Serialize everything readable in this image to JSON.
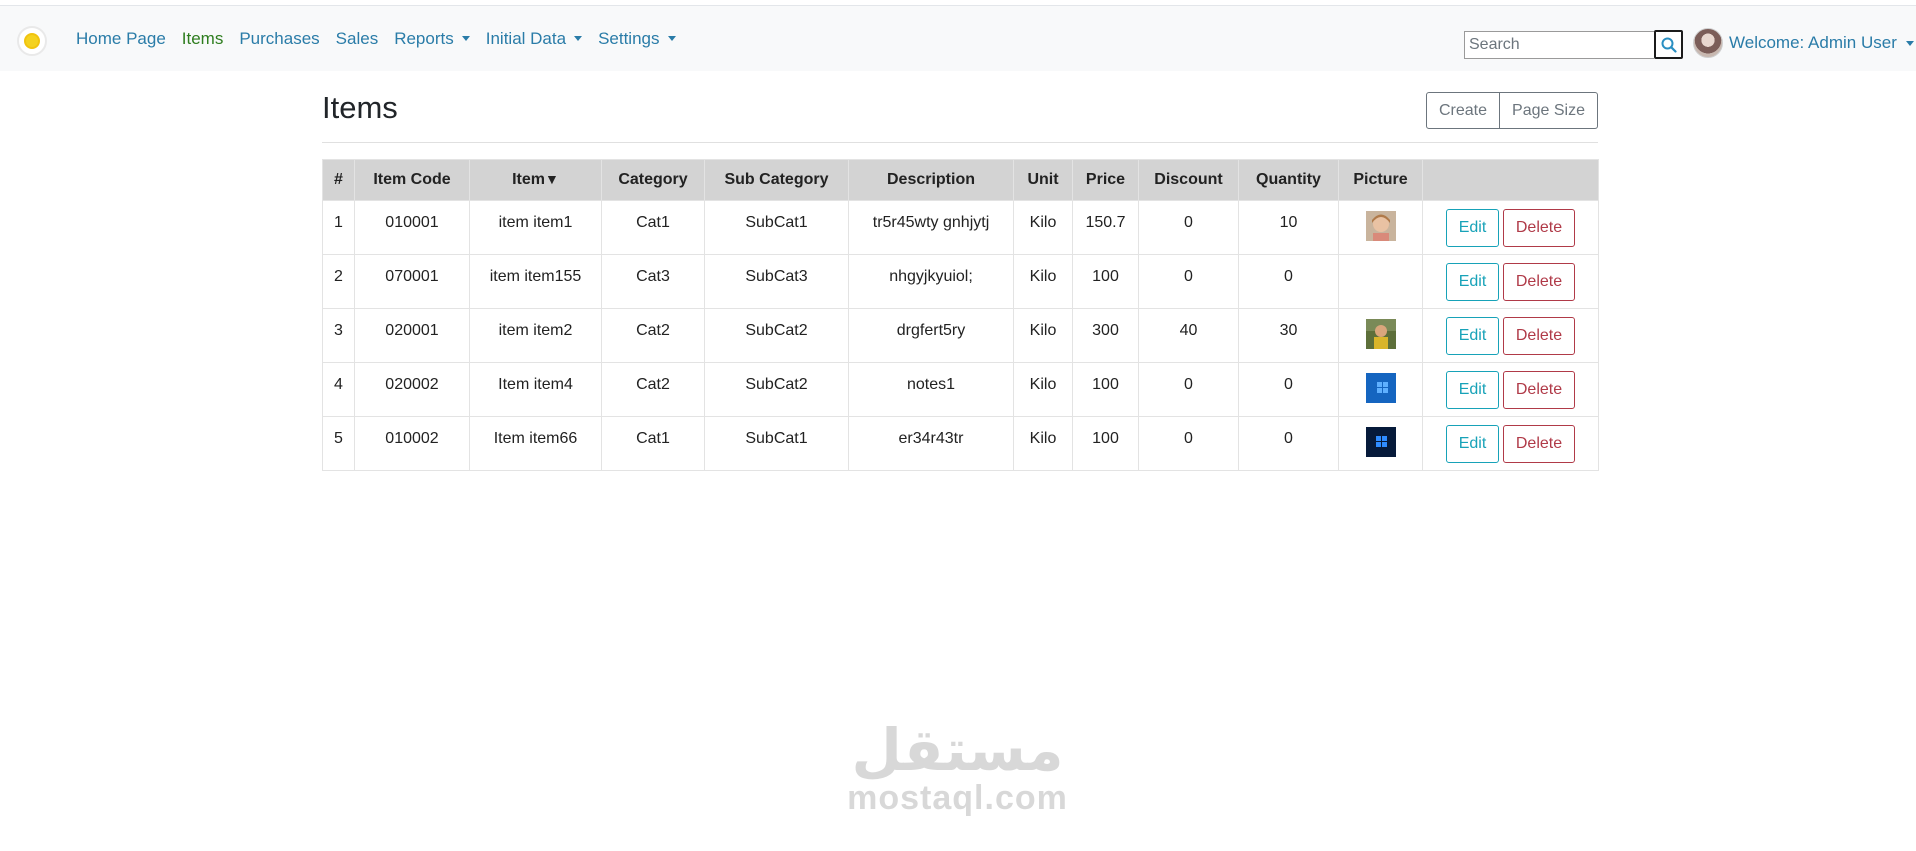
{
  "navbar": {
    "links": [
      {
        "label": "Home Page",
        "dropdown": false,
        "active": false
      },
      {
        "label": "Items",
        "dropdown": false,
        "active": true
      },
      {
        "label": "Purchases",
        "dropdown": false,
        "active": false
      },
      {
        "label": "Sales",
        "dropdown": false,
        "active": false
      },
      {
        "label": "Reports",
        "dropdown": true,
        "active": false
      },
      {
        "label": "Initial Data",
        "dropdown": true,
        "active": false
      },
      {
        "label": "Settings",
        "dropdown": true,
        "active": false
      }
    ],
    "search_placeholder": "Search",
    "search_icon": "search-icon",
    "user_label": "Welcome: Admin User"
  },
  "page": {
    "title": "Items",
    "create_label": "Create",
    "page_size_label": "Page Size"
  },
  "table": {
    "columns": [
      "#",
      "Item Code",
      "Item",
      "Category",
      "Sub Category",
      "Description",
      "Unit",
      "Price",
      "Discount",
      "Quantity",
      "Picture",
      ""
    ],
    "sort_indicator": "▼",
    "edit_label": "Edit",
    "delete_label": "Delete",
    "rows": [
      {
        "num": "1",
        "code": "010001",
        "item": "item item1",
        "category": "Cat1",
        "subcategory": "SubCat1",
        "description": "tr5r45wty gnhjytj",
        "unit": "Kilo",
        "price": "150.7",
        "discount": "0",
        "quantity": "10",
        "picture": "girl-photo"
      },
      {
        "num": "2",
        "code": "070001",
        "item": "item item155",
        "category": "Cat3",
        "subcategory": "SubCat3",
        "description": "nhgyjkyuiol;",
        "unit": "Kilo",
        "price": "100",
        "discount": "0",
        "quantity": "0",
        "picture": ""
      },
      {
        "num": "3",
        "code": "020001",
        "item": "item item2",
        "category": "Cat2",
        "subcategory": "SubCat2",
        "description": "drgfert5ry",
        "unit": "Kilo",
        "price": "300",
        "discount": "40",
        "quantity": "30",
        "picture": "child-photo"
      },
      {
        "num": "4",
        "code": "020002",
        "item": "Item item4",
        "category": "Cat2",
        "subcategory": "SubCat2",
        "description": "notes1",
        "unit": "Kilo",
        "price": "100",
        "discount": "0",
        "quantity": "0",
        "picture": "windows-blue"
      },
      {
        "num": "5",
        "code": "010002",
        "item": "Item item66",
        "category": "Cat1",
        "subcategory": "SubCat1",
        "description": "er34r43tr",
        "unit": "Kilo",
        "price": "100",
        "discount": "0",
        "quantity": "0",
        "picture": "windows-dark"
      }
    ]
  },
  "watermark": {
    "logo_text": "مستقل",
    "text": "mostaql.com"
  },
  "colors": {
    "link": "#2a7ca8",
    "active_link": "#2e7d1e",
    "header_bg": "#d3d3d3",
    "edit": "#17a2b8",
    "delete": "#b03a48"
  }
}
